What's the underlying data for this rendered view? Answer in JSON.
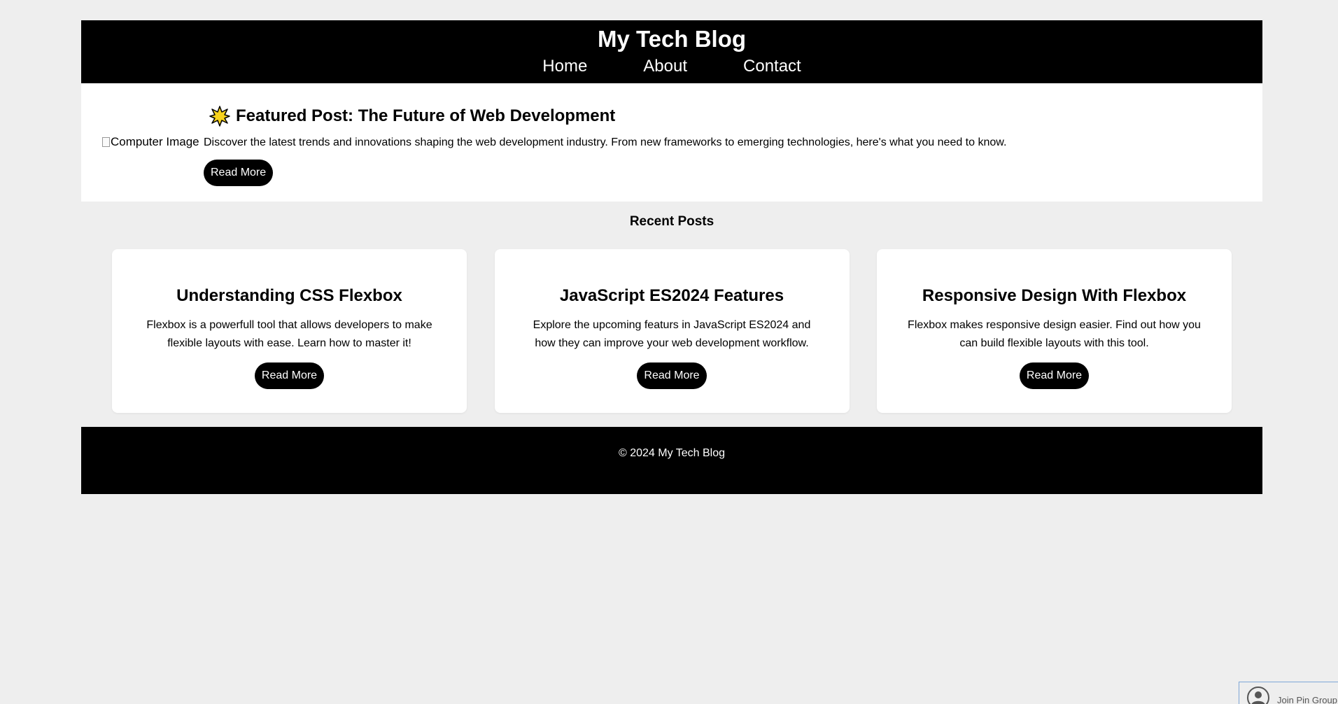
{
  "header": {
    "title": "My Tech Blog",
    "nav": [
      "Home",
      "About",
      "Contact"
    ]
  },
  "featured": {
    "image_alt": "Computer Image",
    "title": "Featured Post: The Future of Web Development",
    "description": "Discover the latest trends and innovations shaping the web development industry. From new frameworks to emerging technologies, here's what you need to know.",
    "button": "Read More"
  },
  "recent": {
    "heading": "Recent Posts",
    "posts": [
      {
        "title": "Understanding CSS Flexbox",
        "description": "Flexbox is a powerfull tool that allows developers to make flexible layouts with ease. Learn how to master it!",
        "button": "Read More"
      },
      {
        "title": "JavaScript ES2024 Features",
        "description": "Explore the upcoming featurs in JavaScript ES2024 and how they can improve your web development workflow.",
        "button": "Read More"
      },
      {
        "title": "Responsive Design With Flexbox",
        "description": "Flexbox makes responsive design easier. Find out how you can build flexible layouts with this tool.",
        "button": "Read More"
      }
    ]
  },
  "footer": {
    "text": "© 2024 My Tech Blog"
  },
  "widget": {
    "label": "Join Pin Group",
    "icon": "user-icon"
  },
  "colors": {
    "background": "#eeeeee",
    "header_bg": "#000000",
    "card_bg": "#ffffff",
    "button_bg": "#000000",
    "star_fill": "#f7d21e"
  }
}
